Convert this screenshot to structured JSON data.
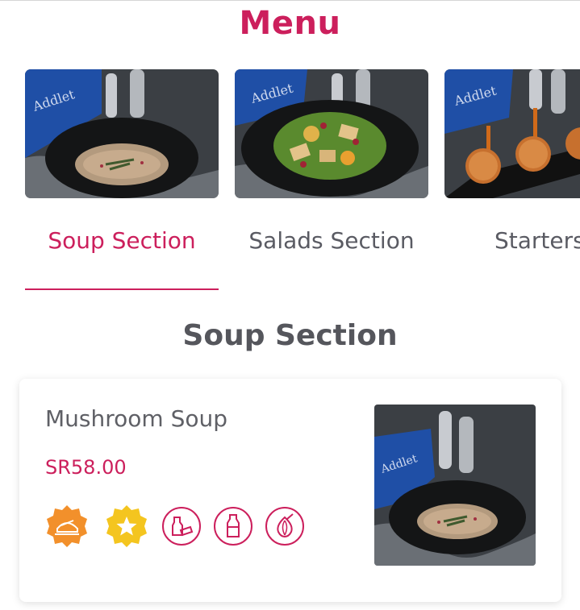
{
  "page": {
    "title": "Menu"
  },
  "tabs": [
    {
      "label": "Soup Section",
      "active": true,
      "photo": "soup-bowl-photo"
    },
    {
      "label": "Salads Section",
      "active": false,
      "photo": "salad-bowl-photo"
    },
    {
      "label": "Starters",
      "active": false,
      "photo": "starters-photo"
    }
  ],
  "section": {
    "heading": "Soup Section"
  },
  "item": {
    "name": "Mushroom Soup",
    "price": "SR58.00",
    "photo": "soup-bowl-photo",
    "badges": [
      {
        "icon": "spicy-chef-icon",
        "style": "filled",
        "color": "#f2902b"
      },
      {
        "icon": "star-icon",
        "style": "filled",
        "color": "#f4c51f"
      },
      {
        "icon": "dairy-icon",
        "style": "outline",
        "color": "#cc1f5c"
      },
      {
        "icon": "milk-bottle-icon",
        "style": "outline",
        "color": "#cc1f5c"
      },
      {
        "icon": "onion-icon",
        "style": "outline",
        "color": "#cc1f5c"
      }
    ]
  },
  "colors": {
    "accent": "#cc1f5c",
    "text": "#5a5b63",
    "napkin": "#1f4fa6"
  },
  "brand": {
    "napkin_text": "Addlet"
  }
}
